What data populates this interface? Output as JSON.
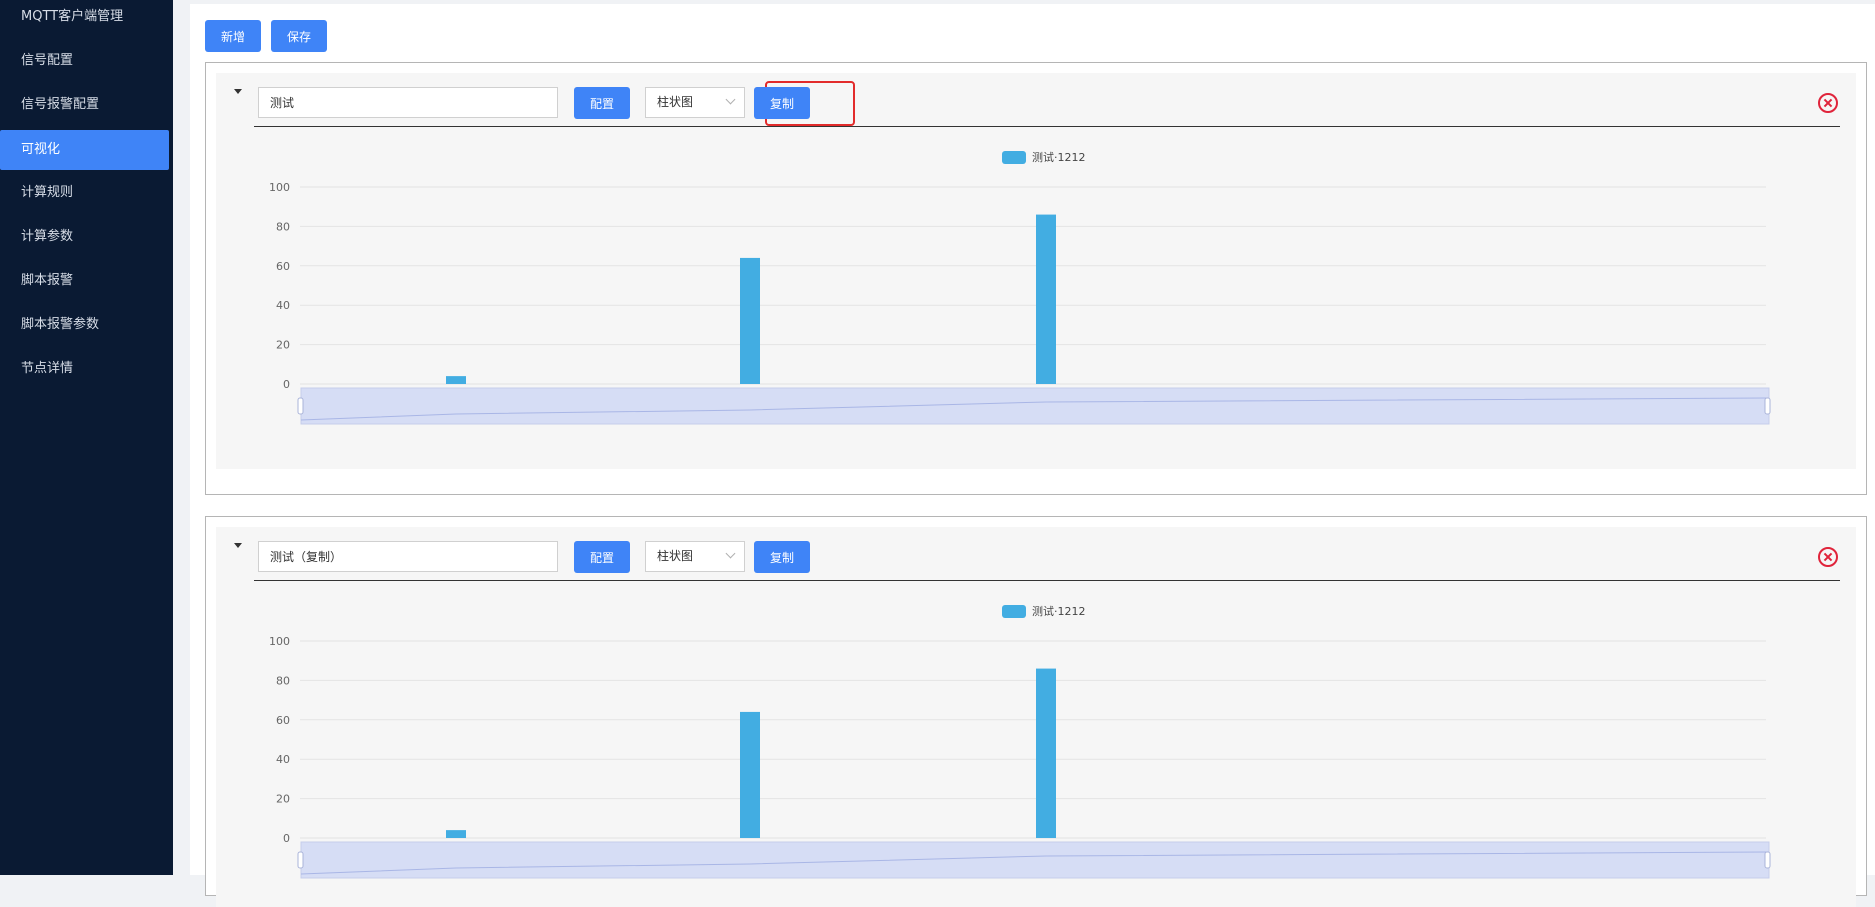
{
  "sidebar": {
    "items": [
      {
        "label": "MQTT客户端管理",
        "active": false
      },
      {
        "label": "信号配置",
        "active": false
      },
      {
        "label": "信号报警配置",
        "active": false
      },
      {
        "label": "可视化",
        "active": true
      },
      {
        "label": "计算规则",
        "active": false
      },
      {
        "label": "计算参数",
        "active": false
      },
      {
        "label": "脚本报警",
        "active": false
      },
      {
        "label": "脚本报警参数",
        "active": false
      },
      {
        "label": "节点详情",
        "active": false
      }
    ]
  },
  "toolbar": {
    "add_label": "新增",
    "save_label": "保存"
  },
  "panels": [
    {
      "name_value": "测试",
      "config_label": "配置",
      "chart_type_selected": "柱状图",
      "copy_label": "复制",
      "copy_highlighted": true
    },
    {
      "name_value": "测试（复制）",
      "config_label": "配置",
      "chart_type_selected": "柱状图",
      "copy_label": "复制",
      "copy_highlighted": false
    }
  ],
  "colors": {
    "accent": "#3f84f7",
    "bar": "#42ade2",
    "close": "#e0243b",
    "highlight": "#e22b2b"
  },
  "chart_data": [
    {
      "type": "bar",
      "series": [
        {
          "name": "测试·1212",
          "values": [
            4,
            64,
            86
          ]
        }
      ],
      "categories": [
        "",
        "",
        ""
      ],
      "ylim": [
        0,
        100
      ],
      "yticks": [
        "0",
        "20",
        "40",
        "60",
        "80",
        "100"
      ],
      "grid": true,
      "legend": "top-center",
      "datazoom_slider": true
    },
    {
      "type": "bar",
      "series": [
        {
          "name": "测试·1212",
          "values": [
            4,
            64,
            86
          ]
        }
      ],
      "categories": [
        "",
        "",
        ""
      ],
      "ylim": [
        0,
        100
      ],
      "yticks": [
        "0",
        "20",
        "40",
        "60",
        "80",
        "100"
      ],
      "grid": true,
      "legend": "top-center",
      "datazoom_slider": true
    }
  ]
}
